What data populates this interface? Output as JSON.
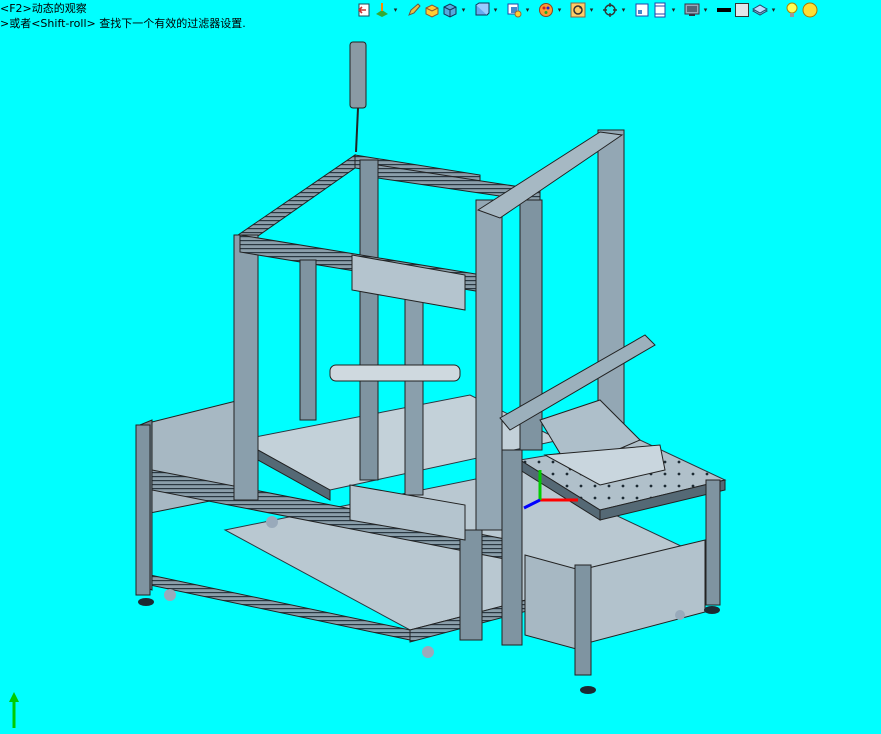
{
  "viewport": {
    "background": "#00ffff",
    "hint_line_1": "<F2>动态的观察",
    "hint_line_2": ">或者<Shift-roll> 查找下一个有效的过滤器设置."
  },
  "toolbar": {
    "buttons": [
      {
        "icon": "previous-view-icon",
        "dropdown": false
      },
      {
        "icon": "view-orientation-icon",
        "dropdown": true
      },
      {
        "icon": "pencil-icon",
        "dropdown": false
      },
      {
        "icon": "section-view-icon",
        "dropdown": false
      },
      {
        "icon": "standard-views-icon",
        "dropdown": true
      },
      {
        "icon": "display-style-icon",
        "dropdown": true
      },
      {
        "icon": "hide-show-items-icon",
        "dropdown": true
      },
      {
        "icon": "edit-appearance-icon",
        "dropdown": true
      },
      {
        "icon": "rotate-view-icon",
        "dropdown": true
      },
      {
        "icon": "zoom-to-fit-icon",
        "dropdown": false
      },
      {
        "icon": "split-view-icon",
        "dropdown": true
      },
      {
        "icon": "monitor-icon",
        "dropdown": true
      },
      {
        "icon": "color-black-icon",
        "dropdown": false
      },
      {
        "icon": "color-swatch-icon",
        "dropdown": false
      },
      {
        "icon": "scene-icon",
        "dropdown": true
      },
      {
        "icon": "light-bulb-icon",
        "dropdown": false
      },
      {
        "icon": "light-sphere-icon",
        "dropdown": false
      }
    ]
  },
  "colors": {
    "frame": "#8fa5b3",
    "frame_dark": "#2b3640",
    "panel": "#b8c8d2",
    "axis_x": "#ff0000",
    "axis_y": "#00cc00",
    "axis_z": "#0000ff"
  }
}
